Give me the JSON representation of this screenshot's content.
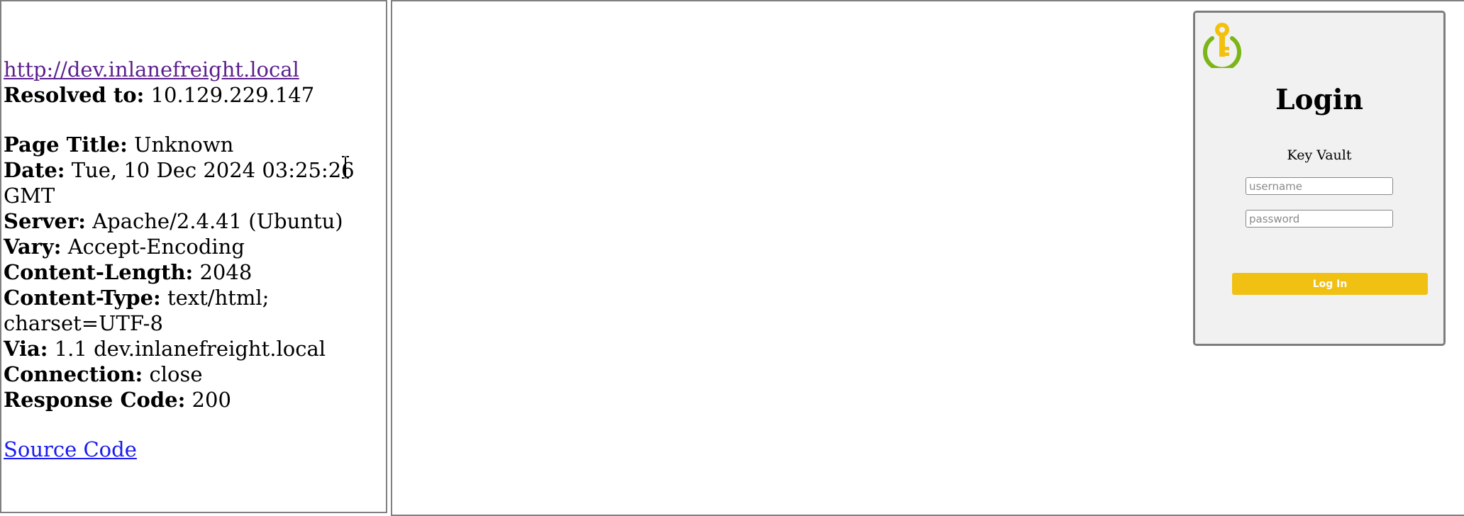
{
  "report": {
    "url": "http://dev.inlanefreight.local",
    "resolved": {
      "label": "Resolved to:",
      "value": "10.129.229.147"
    },
    "page_title": {
      "label": "Page Title:",
      "value": "Unknown"
    },
    "date": {
      "label": "Date:",
      "value": "Tue, 10 Dec 2024 03:25:26 GMT"
    },
    "server": {
      "label": "Server:",
      "value": "Apache/2.4.41 (Ubuntu)"
    },
    "vary": {
      "label": "Vary:",
      "value": "Accept-Encoding"
    },
    "content_length": {
      "label": "Content-Length:",
      "value": "2048"
    },
    "content_type": {
      "label": "Content-Type:",
      "value": "text/html; charset=UTF-8"
    },
    "via": {
      "label": "Via:",
      "value": "1.1 dev.inlanefreight.local"
    },
    "connection": {
      "label": "Connection:",
      "value": "close"
    },
    "response_code": {
      "label": "Response Code:",
      "value": "200"
    },
    "source_link": "Source Code"
  },
  "login_card": {
    "title": "Login",
    "subtitle": "Key Vault",
    "username_placeholder": "username",
    "password_placeholder": "password",
    "button_label": "Log In"
  },
  "colors": {
    "button": "#f0c012",
    "logo_ring": "#7cb518",
    "logo_key": "#f2c10f",
    "visited_link": "#5b1f8f",
    "link": "#1a1aee"
  },
  "icons": {
    "logo": "key-vault-logo-icon",
    "caret": "text-cursor-icon"
  }
}
